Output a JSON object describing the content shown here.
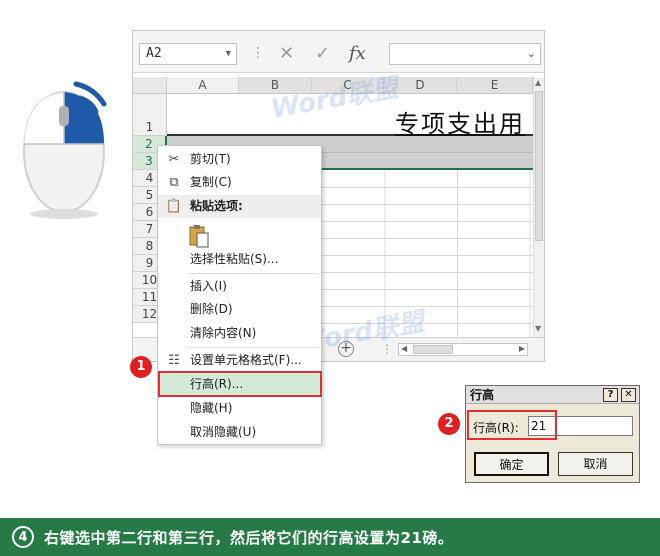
{
  "excel": {
    "name_box": "A2",
    "formula_buttons": {
      "cancel": "✕",
      "enter": "✓",
      "function": "fx"
    },
    "columns": [
      "A",
      "B",
      "C",
      "D",
      "E"
    ],
    "rows": [
      "1",
      "2",
      "3",
      "4",
      "5",
      "6",
      "7",
      "8",
      "9",
      "10",
      "11",
      "12"
    ],
    "title_text": "专项支出用",
    "add_sheet": "+"
  },
  "watermark": {
    "text": "Word联盟"
  },
  "context_menu": {
    "items": [
      {
        "label": "剪切(T)",
        "icon": "scissors-icon"
      },
      {
        "label": "复制(C)",
        "icon": "copy-icon"
      },
      {
        "label": "粘贴选项:",
        "icon": "clipboard-icon"
      },
      {
        "label": "选择性粘贴(S)..."
      },
      {
        "label": "插入(I)"
      },
      {
        "label": "删除(D)"
      },
      {
        "label": "清除内容(N)"
      },
      {
        "label": "设置单元格格式(F)...",
        "icon": "format-cells-icon"
      },
      {
        "label": "行高(R)..."
      },
      {
        "label": "隐藏(H)"
      },
      {
        "label": "取消隐藏(U)"
      }
    ]
  },
  "steps": {
    "one": "1",
    "two": "2"
  },
  "dialog": {
    "title": "行高",
    "help_btn": "?",
    "close_btn": "✕",
    "label": "行高(R):",
    "value": "21",
    "ok": "确定",
    "cancel": "取消"
  },
  "banner": {
    "number": "4",
    "text": "右键选中第二行和第三行，然后将它们的行高设置为21磅。",
    "color": "#267a45"
  },
  "colors": {
    "excel_green": "#217346",
    "highlight_red": "#e03030"
  }
}
